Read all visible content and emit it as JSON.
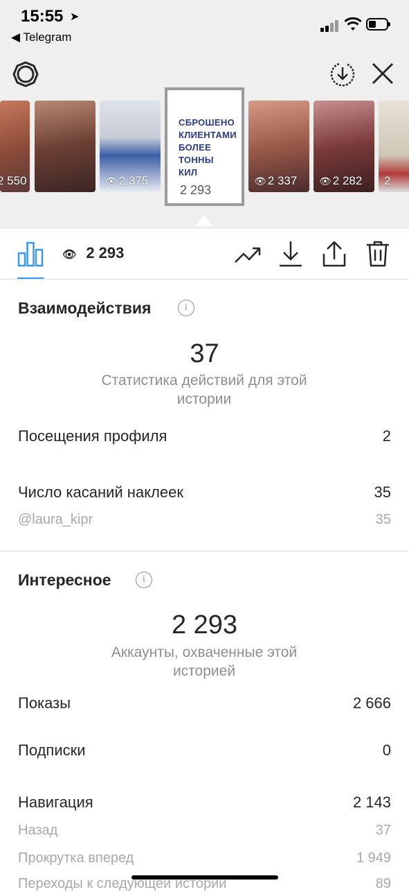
{
  "status": {
    "time": "15:55",
    "back_label": "◀ Telegram"
  },
  "stories": [
    {
      "views": "2 550"
    },
    {
      "views": ""
    },
    {
      "views": "2 375"
    },
    {
      "views": "2 293",
      "text": "СБРОШЕНО КЛИЕНТАМИ БОЛЕЕ ТОННЫ КИЛ",
      "tag": "@laura_kipr"
    },
    {
      "views": "2 337"
    },
    {
      "views": "2 282"
    },
    {
      "views": "2"
    }
  ],
  "toolbar": {
    "views": "2 293"
  },
  "interactions": {
    "title": "Взаимодействия",
    "total": "37",
    "caption": "Статистика действий для этой истории",
    "rows": [
      {
        "label": "Посещения профиля",
        "value": "2"
      },
      {
        "label": "Число касаний наклеек",
        "value": "35"
      },
      {
        "label": "@laura_kipr",
        "value": "35"
      }
    ]
  },
  "discovery": {
    "title": "Интересное",
    "total": "2 293",
    "caption": "Аккаунты, охваченные этой историей",
    "rows": [
      {
        "label": "Показы",
        "value": "2 666"
      },
      {
        "label": "Подписки",
        "value": "0"
      },
      {
        "label": "Навигация",
        "value": "2 143"
      },
      {
        "label": "Назад",
        "value": "37"
      },
      {
        "label": "Прокрутка вперед",
        "value": "1 949"
      },
      {
        "label": "Переходы к следующей истории",
        "value": "89"
      }
    ]
  },
  "colors": {
    "accent": "#3897f0",
    "secondary_text": "#8e8e8e"
  }
}
